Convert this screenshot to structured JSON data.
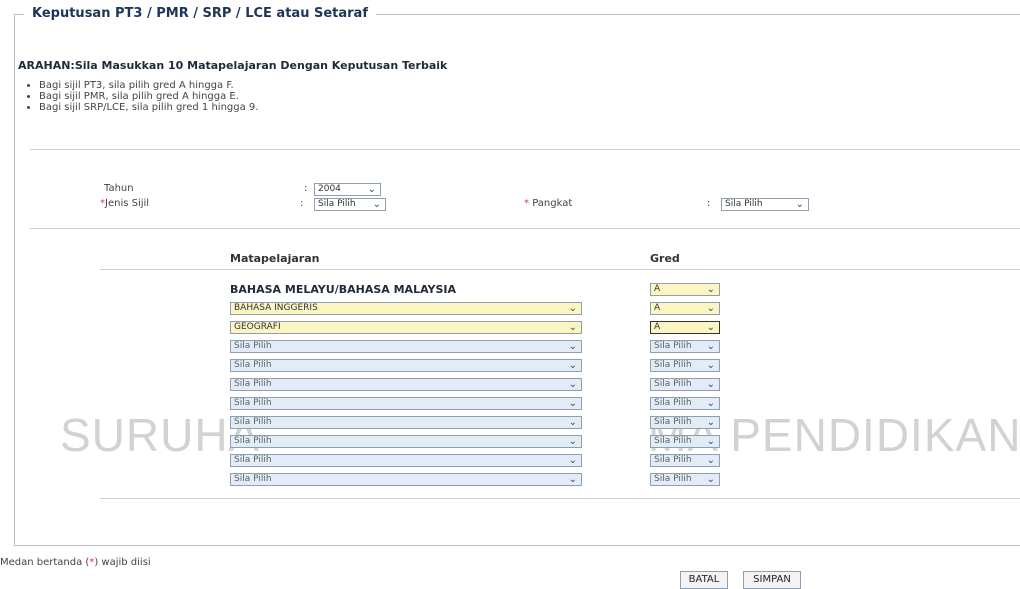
{
  "legend": "Keputusan PT3 / PMR / SRP / LCE atau Setaraf",
  "watermark": {
    "left": "SURUHA",
    "right": "MA  PENDIDIKAN"
  },
  "instructions": {
    "title": "ARAHAN:Sila Masukkan 10 Matapelajaran Dengan Keputusan Terbaik",
    "items": [
      "Bagi sijil PT3, sila pilih gred A hingga F.",
      "Bagi sijil PMR, sila pilih gred A hingga E.",
      "Bagi sijil SRP/LCE, sila pilih gred 1 hingga 9."
    ]
  },
  "form": {
    "tahun_label": "Tahun",
    "tahun_value": "2004",
    "jenis_sijil_label": "Jenis Sijil",
    "jenis_sijil_value": "Sila Pilih",
    "pangkat_label": "Pangkat",
    "pangkat_value": "Sila Pilih",
    "required_mark": "*",
    "colon": ":"
  },
  "table": {
    "col_subject": "Matapelajaran",
    "col_grade": "Gred",
    "fixed_subject": "BAHASA MELAYU/BAHASA MALAYSIA",
    "fixed_grade": "A",
    "rows": [
      {
        "subject": "BAHASA INGGERIS",
        "grade": "A"
      },
      {
        "subject": "GEOGRAFI",
        "grade": "A"
      },
      {
        "subject": "Sila Pilih",
        "grade": "Sila Pilih"
      },
      {
        "subject": "Sila Pilih",
        "grade": "Sila Pilih"
      },
      {
        "subject": "Sila Pilih",
        "grade": "Sila Pilih"
      },
      {
        "subject": "Sila Pilih",
        "grade": "Sila Pilih"
      },
      {
        "subject": "Sila Pilih",
        "grade": "Sila Pilih"
      },
      {
        "subject": "Sila Pilih",
        "grade": "Sila Pilih"
      },
      {
        "subject": "Sila Pilih",
        "grade": "Sila Pilih"
      },
      {
        "subject": "Sila Pilih",
        "grade": "Sila Pilih"
      }
    ]
  },
  "footer": {
    "note_before": "Medan bertanda (",
    "note_mark": "*",
    "note_after": ") wajib diisi",
    "cancel_label": "BATAL",
    "save_label": "SIMPAN"
  },
  "colors": {
    "required": "#e0304f",
    "filled_select": "#fbf6c1",
    "empty_select": "#e3ecf6"
  }
}
